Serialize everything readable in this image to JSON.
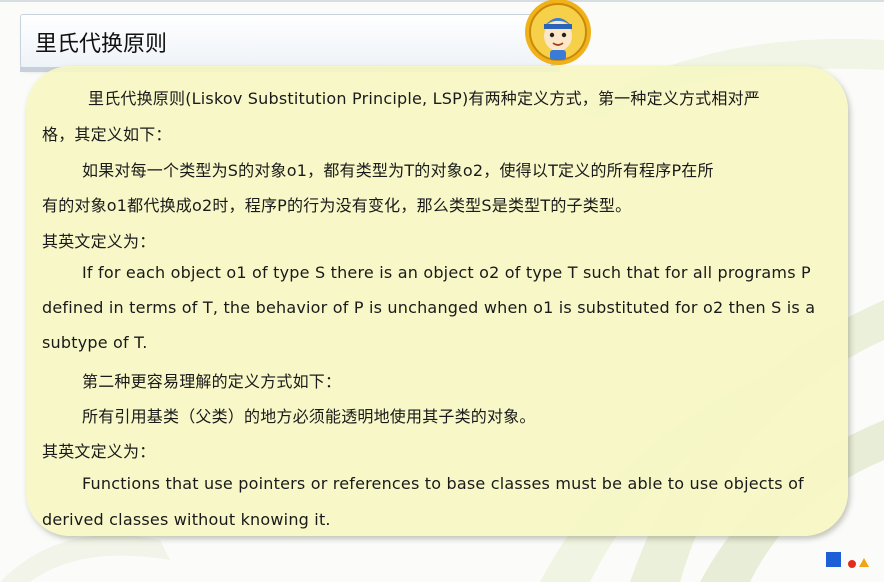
{
  "slide": {
    "title": "里氏代换原则",
    "lines": [
      "里氏代换原则(Liskov Substitution Principle, LSP)有两种定义方式，第一种定义方式相对严",
      "格，其定义如下：",
      "如果对每一个类型为S的对象o1，都有类型为T的对象o2，使得以T定义的所有程序P在所",
      "有的对象o1都代换成o2时，程序P的行为没有变化，那么类型S是类型T的子类型。",
      "其英文定义为：",
      "If for each object o1 of type S there is an object o2 of type T such that for all programs P",
      "defined in terms of T, the behavior of P is unchanged when o1 is substituted for o2 then S is a",
      "subtype of T.",
      "第二种更容易理解的定义方式如下：",
      "所有引用基类（父类）的地方必须能透明地使用其子类的对象。",
      "其英文定义为：",
      "Functions that use pointers or references to base classes must be able to use objects of",
      "derived classes without knowing it."
    ]
  },
  "colors": {
    "card": "#f6f6c4",
    "badge_ring": "#f0b11a",
    "footer_square": "#1d5fd6",
    "footer_dot": "#e32a1c",
    "footer_triangle": "#f2a413"
  },
  "icons": {
    "badge": "cartoon-mascot-badge-icon",
    "footer": "slide-nav-shapes-icon"
  }
}
